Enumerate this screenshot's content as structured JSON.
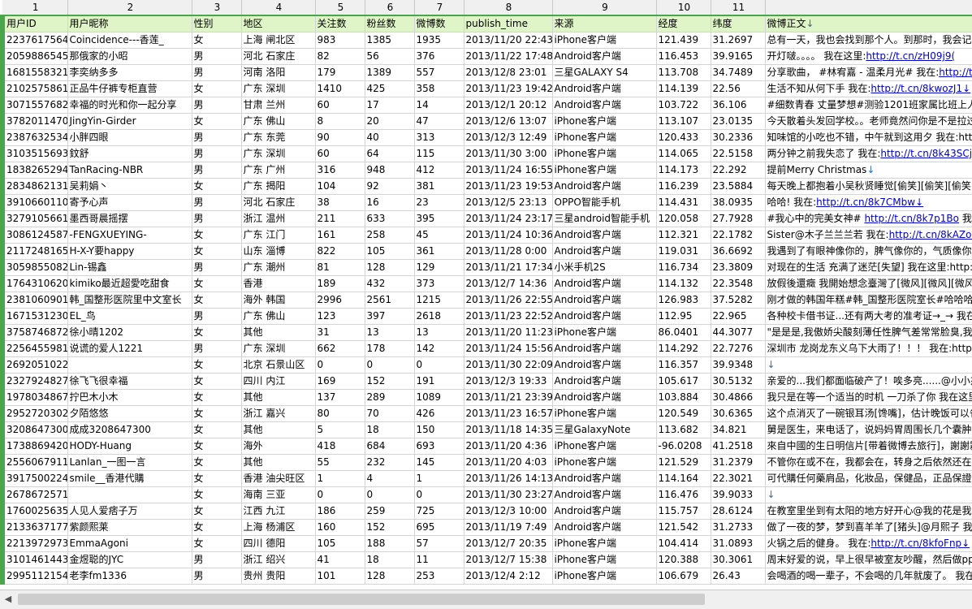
{
  "columns": [
    "1",
    "2",
    "3",
    "4",
    "5",
    "6",
    "7",
    "8",
    "9",
    "10",
    "11",
    ""
  ],
  "header": [
    "用户ID",
    "用户昵称",
    "性别",
    "地区",
    "关注数",
    "粉丝数",
    "微博数",
    "publish_time",
    "来源",
    "经度",
    "纬度",
    "微博正文"
  ],
  "rows": [
    [
      "2237617564",
      "Coincidence---香莲_",
      "女",
      "上海 闸北区",
      "983",
      "1385",
      "1935",
      "2013/11/20 22:43",
      "iPhone客户端",
      "121.439",
      "31.2697",
      "总有一天，我也会找到那个人。到那时，我会记起"
    ],
    [
      "2059886545",
      "那俄家的小昭",
      "男",
      "河北 石家庄",
      "82",
      "56",
      "376",
      "2013/11/22 17:48",
      "Android客户端",
      "116.453",
      "39.9165",
      "开灯啵。。。。 我在这里:http://t.cn/zH09j9("
    ],
    [
      "1681558321",
      "李奕纳多多",
      "男",
      "河南 洛阳",
      "179",
      "1389",
      "557",
      "2013/12/8 23:01",
      "三星GALAXY S4",
      "113.708",
      "34.7489",
      "分享歌曲，  #林宥嘉 - 温柔月光# 我在:http://t.c"
    ],
    [
      "2102575861",
      "正品牛仔裤专柜直营",
      "女",
      "广东 深圳",
      "1410",
      "425",
      "358",
      "2013/11/23 19:42",
      "Android客户端",
      "114.139",
      "22.56",
      "生活不知从何下手 我在:http://t.cn/8kwozJ1↓"
    ],
    [
      "3071557682",
      "幸福的时光和你一起分享",
      "男",
      "甘肃 兰州",
      "60",
      "17",
      "14",
      "2013/12/1 20:12",
      "Android客户端",
      "103.722",
      "36.106",
      "#细数青春 丈量梦想#测验1201班家属比班上人多"
    ],
    [
      "3782011470",
      "JingYin-Girder",
      "女",
      "广东 佛山",
      "8",
      "20",
      "47",
      "2013/12/6 13:07",
      "iPhone客户端",
      "113.107",
      "23.0135",
      "今天散着头发回学校。。老师竟然问你是不是拉过"
    ],
    [
      "2387632534",
      "小胖四眼",
      "男",
      "广东 东莞",
      "90",
      "40",
      "313",
      "2013/12/3 12:49",
      "iPhone客户端",
      "120.433",
      "30.2336",
      "知味馆的小吃也不错，中午就到这用夕 我在:http"
    ],
    [
      "3103515693",
      "鈫舒",
      "男",
      "广东 深圳",
      "60",
      "64",
      "115",
      "2013/11/30 3:00",
      "iPhone客户端",
      "114.065",
      "22.5158",
      "两分钟之前我失恋了 我在:http://t.cn/8k43SCj↓"
    ],
    [
      "1838265294",
      "TanRacing-NBR",
      "男",
      "广东 广州",
      "316",
      "948",
      "412",
      "2013/11/24 16:55",
      "iPhone客户端",
      "114.173",
      "22.292",
      "提前Merry Christmas↓"
    ],
    [
      "2834862131",
      "吴莉娟丶",
      "女",
      "广东 揭阳",
      "104",
      "92",
      "381",
      "2013/11/23 19:53",
      "Android客户端",
      "116.239",
      "23.5884",
      "每天晚上都抱着小吴秋贤睡觉[偷笑][偷笑][偷笑]@"
    ],
    [
      "3910660110",
      "寄予心声",
      "男",
      "河北 石家庄",
      "38",
      "16",
      "23",
      "2013/12/5 23:13",
      "OPPO智能手机",
      "114.431",
      "38.0935",
      "哈哈! 我在:http://t.cn/8k7CMbw↓"
    ],
    [
      "3279105661",
      "墨西哥晨摇摆",
      "男",
      "浙江 温州",
      "211",
      "633",
      "395",
      "2013/11/24 23:17",
      "三星android智能手机",
      "120.058",
      "27.7928",
      "#我心中的完美女神# http://t.cn/8k7p1Bo 我在"
    ],
    [
      "3086124587",
      "-FENGXUEYING-",
      "女",
      "广东 江门",
      "161",
      "258",
      "45",
      "2013/11/24 10:36",
      "Android客户端",
      "112.321",
      "22.1782",
      "Sister@木子兰兰兰若 我在:http://t.cn/8kAZokJ"
    ],
    [
      "2117248165",
      "H-X-Y要happy",
      "女",
      "山东 淄博",
      "822",
      "105",
      "361",
      "2013/11/28 0:00",
      "Android客户端",
      "119.031",
      "36.6692",
      "我遇到了有眼神像你的，脾气像你的，气质像你的"
    ],
    [
      "3059855082",
      "Lin-锡鑫",
      "男",
      "广东 潮州",
      "81",
      "128",
      "129",
      "2013/11/21 17:34",
      "小米手机2S",
      "116.734",
      "23.3809",
      "对现在的生活   充满了迷茫[失望] 我在这里:http:"
    ],
    [
      "1764310620",
      "kimiko最近超愛吃甜食",
      "女",
      "香港",
      "189",
      "432",
      "373",
      "2013/12/7 14:36",
      "Android客户端",
      "114.132",
      "22.3548",
      "放假後還癥 我開始想念臺灣了[微风][微风][微风]"
    ],
    [
      "2381060901",
      "韩_国整形医院里中文室长",
      "女",
      "海外 韩国",
      "2996",
      "2561",
      "1215",
      "2013/11/26 22:55",
      "Android客户端",
      "126.983",
      "37.5282",
      "刚才做的韩国年糕#韩_国整形医院室长#哈哈哈 我"
    ],
    [
      "1671531230",
      "EL_鸟",
      "男",
      "广东 佛山",
      "123",
      "397",
      "2618",
      "2013/11/23 22:52",
      "Android客户端",
      "112.95",
      "22.965",
      "各种校卡借书证...还有两大考的准考证→_→ 我在"
    ],
    [
      "3758746872",
      "徐小晴1202",
      "女",
      "其他",
      "31",
      "13",
      "13",
      "2013/11/20 11:23",
      "iPhone客户端",
      "86.0401",
      "44.3077",
      "\"是是是,我傲娇尖酸刻薄任性脾气差常常脸臭,我无"
    ],
    [
      "2256455981",
      "说谎的爱人1221",
      "男",
      "广东 深圳",
      "662",
      "178",
      "142",
      "2013/11/24 15:56",
      "Android客户端",
      "114.292",
      "22.7276",
      "深圳市 龙岗龙东义乌下大雨了！！！ 我在:http:"
    ],
    [
      "2692051022",
      "",
      "女",
      "北京 石景山区",
      "0",
      "0",
      "0",
      "2013/11/30 22:09",
      "Android客户端",
      "116.357",
      "39.9348",
      "↓"
    ],
    [
      "2327924827",
      "徐飞飞很幸福",
      "女",
      "四川 内江",
      "169",
      "152",
      "191",
      "2013/12/3 19:33",
      "Android客户端",
      "105.617",
      "30.5132",
      "亲爱的...我们都面临破产了！唉多亮......@小小杰"
    ],
    [
      "1978034867",
      "拧巴木小木",
      "女",
      "其他",
      "137",
      "289",
      "1089",
      "2013/11/21 23:39",
      "Android客户端",
      "103.884",
      "30.4866",
      "我只是在等一个适当的时机 一刀杀了你 我在这里"
    ],
    [
      "2952720302",
      "夕陌悠悠",
      "女",
      "浙江 嘉兴",
      "80",
      "70",
      "426",
      "2013/11/23 16:57",
      "iPhone客户端",
      "120.549",
      "30.6365",
      "这个点消灭了一碗银耳汤[馋嘴]，估计晚饭可以省"
    ],
    [
      "3208647300",
      "成成3208647300",
      "女",
      "其他",
      "5",
      "18",
      "150",
      "2013/11/18 14:35",
      "三星GalaxyNote",
      "113.682",
      "34.821",
      "舅是医生，来电话了，说妈妈胃周围长几个囊肿，"
    ],
    [
      "1738869420",
      "HODY-Huang",
      "女",
      "海外",
      "418",
      "684",
      "693",
      "2013/11/20 4:36",
      "iPhone客户端",
      "-96.0208",
      "41.2518",
      "來自中國的生日明信片[带着微博去旅行]，謝謝霧"
    ],
    [
      "2556067911",
      "Lanlan_一图一言",
      "女",
      "其他",
      "55",
      "232",
      "145",
      "2013/11/20 4:03",
      "iPhone客户端",
      "121.529",
      "31.2379",
      "不管你在或不在，我都会在，转身之后依然还在。"
    ],
    [
      "3917500224",
      "smile__香港代購",
      "女",
      "香港 油尖旺区",
      "1",
      "4",
      "1",
      "2013/11/26 14:13",
      "Android客户端",
      "114.164",
      "22.3021",
      "可代購任何藥肩品，化妝品，保健品，正品保證哦"
    ],
    [
      "2678672571",
      "",
      "女",
      "海南 三亚",
      "0",
      "0",
      "0",
      "2013/11/30 23:27",
      "Android客户端",
      "116.476",
      "39.9033",
      "↓"
    ],
    [
      "1760025635",
      "人见人爱痞子万",
      "女",
      "江西 九江",
      "186",
      "259",
      "725",
      "2013/12/3 10:00",
      "Android客户端",
      "115.757",
      "28.6124",
      "在教室里坐到有太阳的地方好开心@我的花是我是"
    ],
    [
      "2133637177",
      "紫颜熙莱",
      "女",
      "上海 杨浦区",
      "160",
      "152",
      "695",
      "2013/11/19 7:49",
      "Android客户端",
      "121.542",
      "31.2733",
      "做了一夜的梦，梦到喜羊羊了[猪头]@月熙子 我在"
    ],
    [
      "2213972973",
      "EmmaAgoni",
      "女",
      "四川 德阳",
      "105",
      "188",
      "57",
      "2013/12/7 20:35",
      "iPhone客户端",
      "104.414",
      "31.0893",
      "火锅之后的健身。 我在:http://t.cn/8kfoFnp↓"
    ],
    [
      "3101461443",
      "金煜聪的JYC",
      "男",
      "浙江 绍兴",
      "41",
      "18",
      "11",
      "2013/12/7 15:38",
      "iPhone客户端",
      "120.388",
      "30.3061",
      "周末好爱的说，早上很早被室友吵醒，然后做ppt"
    ],
    [
      "2995112154",
      "老李fm1336",
      "男",
      "贵州 贵阳",
      "101",
      "128",
      "253",
      "2013/12/4 2:12",
      "iPhone客户端",
      "106.679",
      "26.43",
      "会喝酒的喝一辈子，不会喝的几年就废了。 我在:"
    ]
  ]
}
